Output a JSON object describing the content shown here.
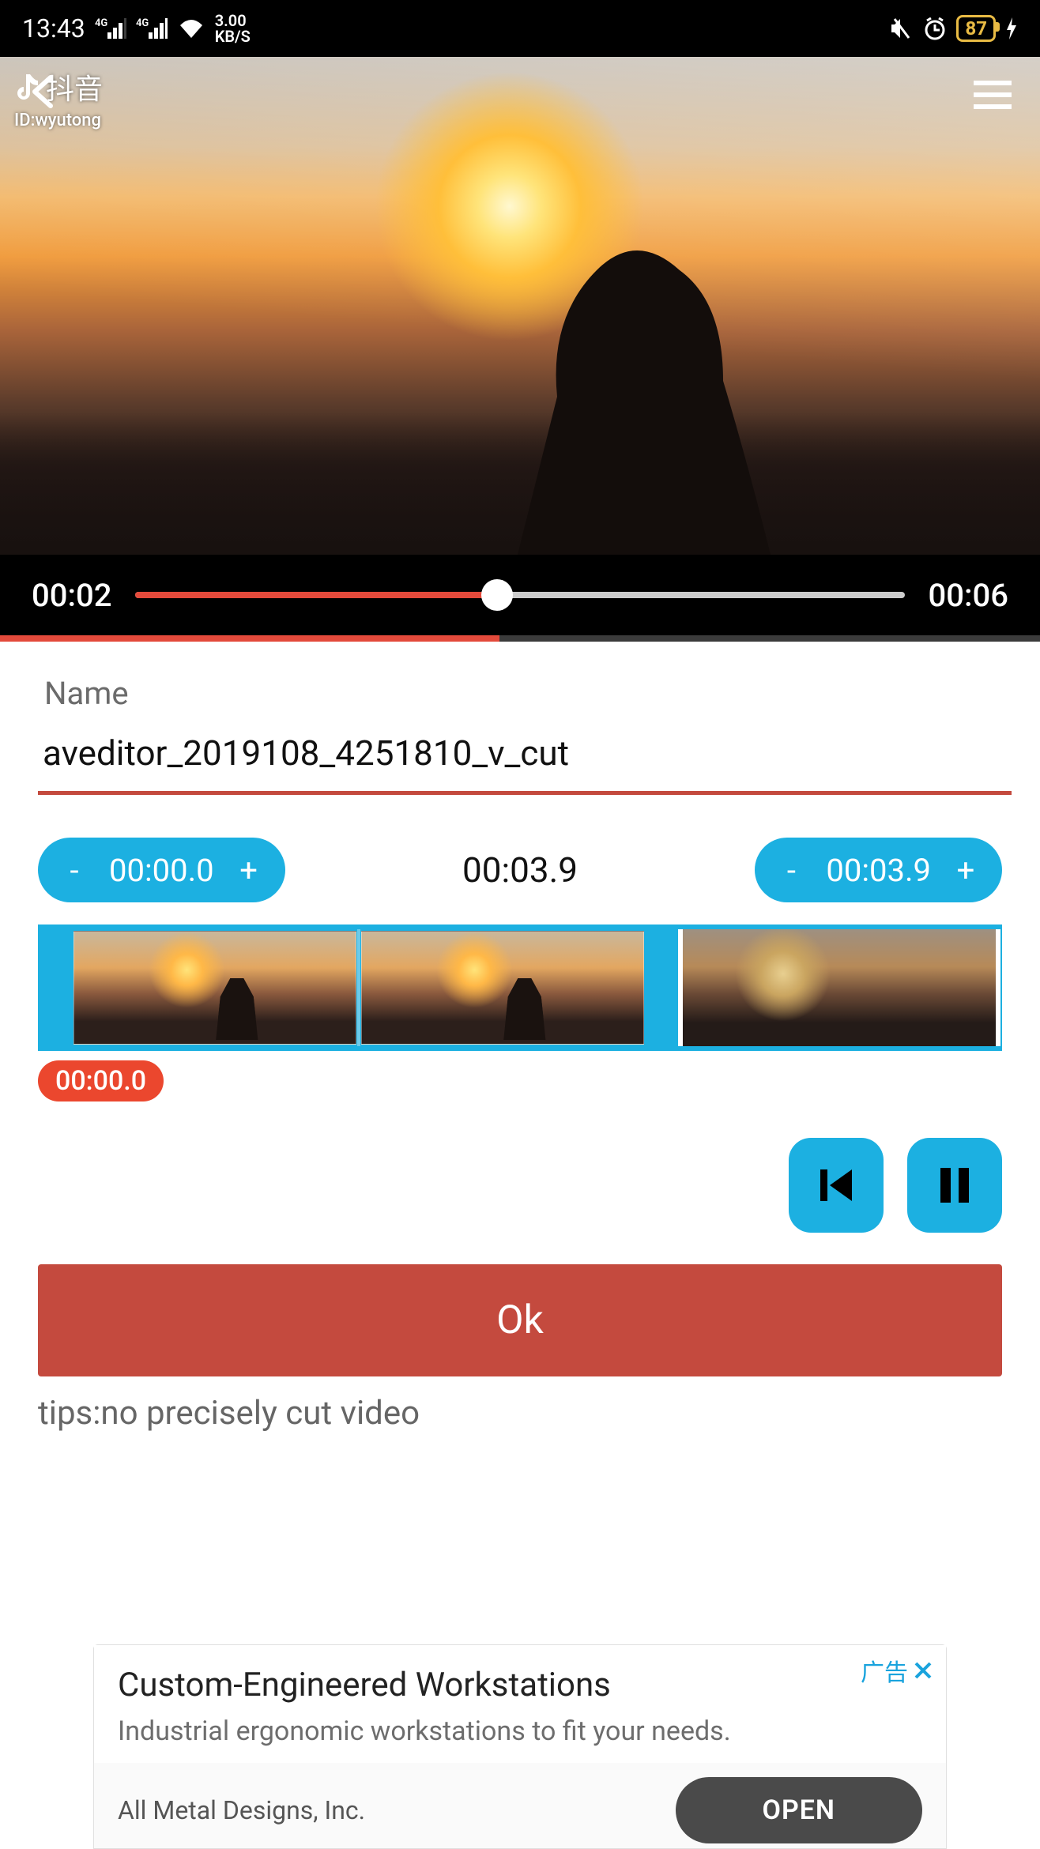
{
  "statusbar": {
    "time": "13:43",
    "net_speed_top": "3.00",
    "net_speed_bot": "KB/S",
    "battery": "87"
  },
  "video": {
    "watermark_app": "抖音",
    "watermark_id": "ID:wyutong",
    "elapsed": "00:02",
    "total": "00:06"
  },
  "form": {
    "name_label": "Name",
    "name_value": "aveditor_2019108_4251810_v_cut",
    "start_time": "00:00.0",
    "clip_duration": "00:03.9",
    "end_time": "00:03.9",
    "minus": "-",
    "plus": "+",
    "pos_badge": "00:00.0",
    "ok": "Ok",
    "tips": "tips:no precisely cut video"
  },
  "ad": {
    "tag": "广告",
    "title": "Custom-Engineered Workstations",
    "sub": "Industrial ergonomic workstations to fit your needs.",
    "advertiser": "All Metal Designs, Inc.",
    "cta": "OPEN"
  }
}
